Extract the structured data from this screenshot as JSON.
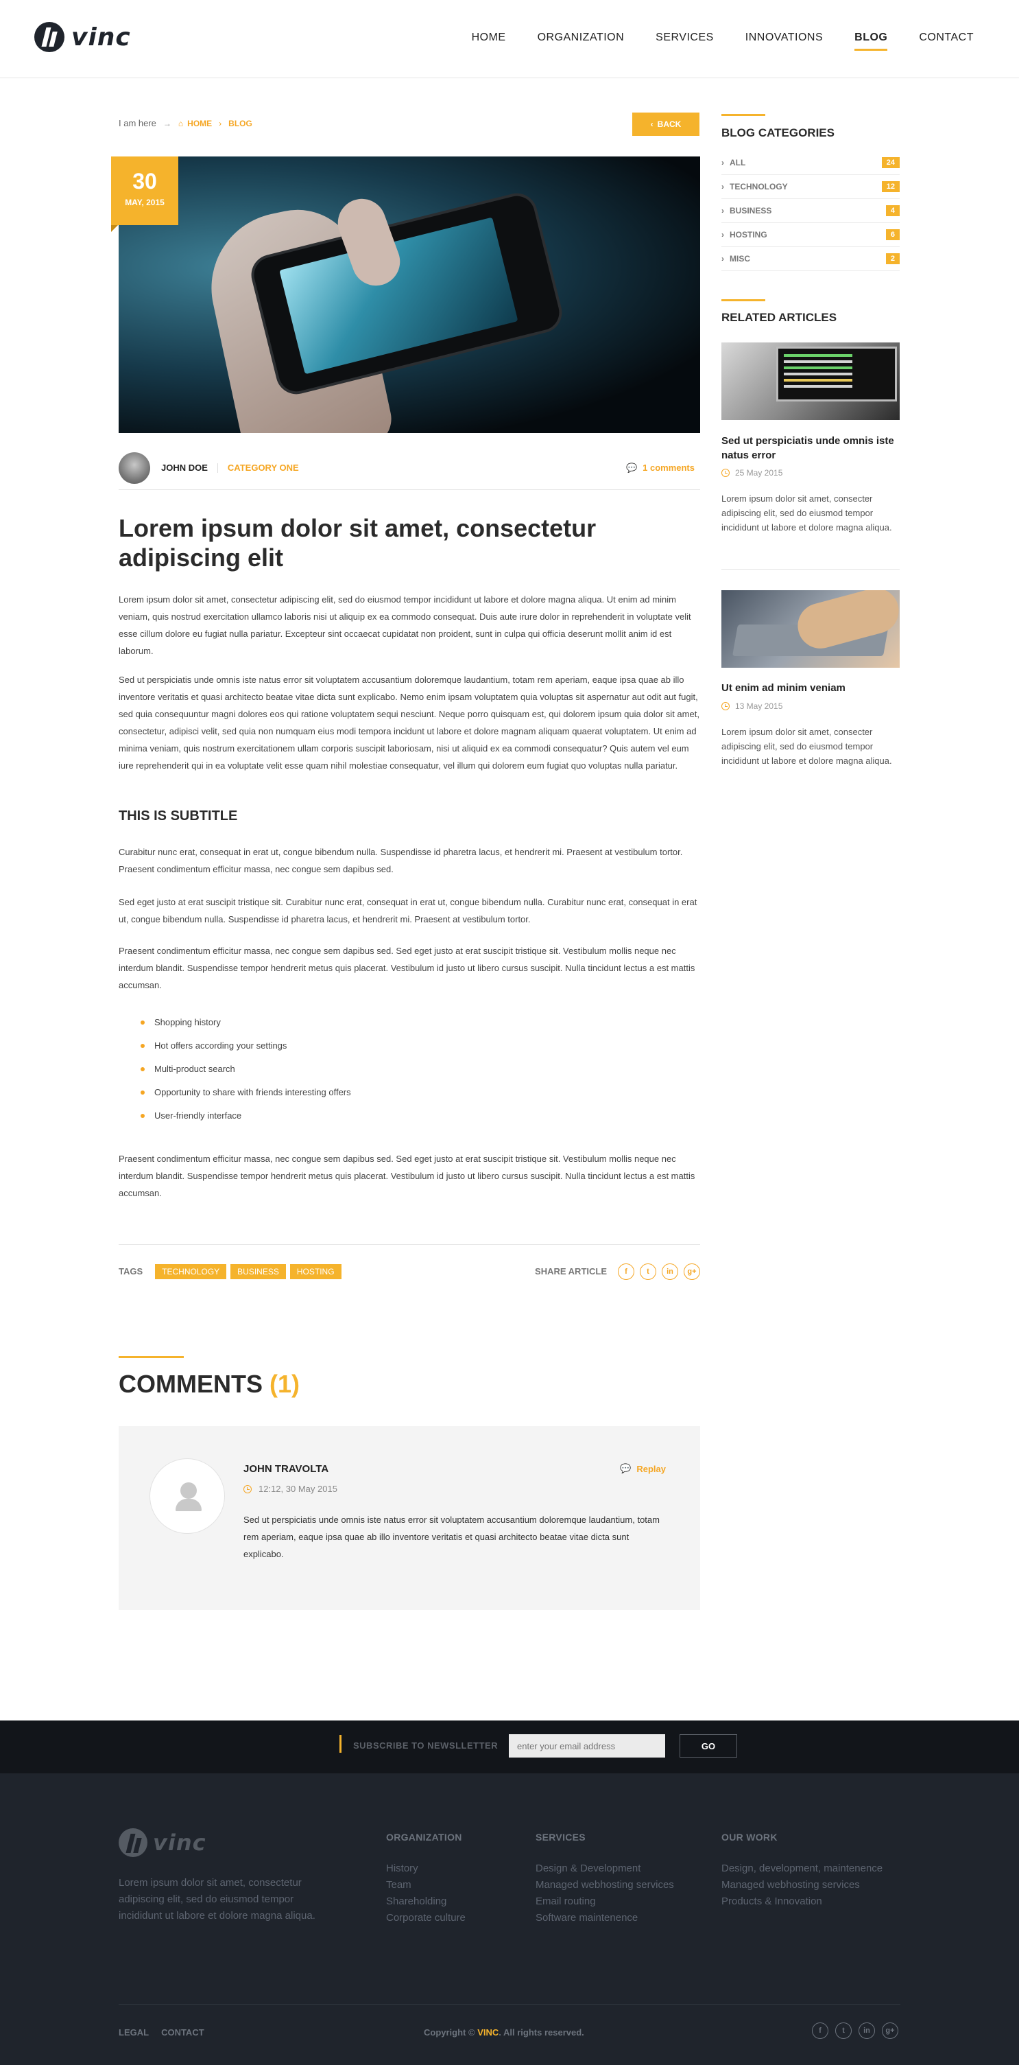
{
  "brand": {
    "logo_text": "vinc"
  },
  "nav": {
    "items": [
      {
        "label": "HOME"
      },
      {
        "label": "ORGANIZATION"
      },
      {
        "label": "SERVICES"
      },
      {
        "label": "INNOVATIONS"
      },
      {
        "label": "BLOG",
        "active": true
      },
      {
        "label": "CONTACT"
      }
    ]
  },
  "breadcrumb": {
    "prefix": "I am here",
    "home": "HOME",
    "current": "BLOG"
  },
  "back_button": {
    "label": "BACK"
  },
  "post": {
    "date_day": "30",
    "date_month": "MAY, 2015",
    "author": "JOHN DOE",
    "category": "CATEGORY ONE",
    "comments_link": "1 comments",
    "title": "Lorem ipsum dolor sit amet, consectetur adipiscing elit",
    "p1": "Lorem ipsum dolor sit amet, consectetur adipiscing elit, sed do eiusmod tempor incididunt ut labore et dolore magna aliqua. Ut enim ad minim veniam, quis nostrud exercitation ullamco laboris nisi ut aliquip ex ea commodo consequat. Duis aute irure dolor in reprehenderit in voluptate velit esse cillum dolore eu fugiat nulla pariatur. Excepteur sint occaecat cupidatat non proident, sunt in culpa qui officia deserunt mollit anim id est laborum.",
    "p2": "Sed ut perspiciatis unde omnis iste natus error sit voluptatem accusantium doloremque laudantium, totam rem aperiam, eaque ipsa quae ab illo inventore veritatis et quasi architecto beatae vitae dicta sunt explicabo. Nemo enim ipsam voluptatem quia voluptas sit aspernatur aut odit aut fugit, sed quia consequuntur magni dolores eos qui ratione voluptatem sequi nesciunt. Neque porro quisquam est, qui dolorem ipsum quia dolor sit amet, consectetur, adipisci velit, sed quia non numquam eius modi tempora incidunt ut labore et dolore magnam aliquam quaerat voluptatem. Ut enim ad minima veniam, quis nostrum exercitationem ullam corporis suscipit laboriosam, nisi ut aliquid ex ea commodi consequatur? Quis autem vel eum iure reprehenderit qui in ea voluptate velit esse quam nihil molestiae consequatur, vel illum qui dolorem eum fugiat quo voluptas nulla pariatur.",
    "subtitle": "THIS IS SUBTITLE",
    "p3": "Curabitur nunc erat, consequat in erat ut, congue bibendum nulla. Suspendisse id pharetra lacus, et hendrerit mi. Praesent at vestibulum tortor. Praesent condimentum efficitur massa, nec congue sem dapibus sed.",
    "p4": "Sed eget justo at erat suscipit tristique sit. Curabitur nunc erat, consequat in erat ut, congue bibendum nulla. Curabitur nunc erat, consequat in erat ut, congue bibendum nulla. Suspendisse id pharetra lacus, et hendrerit mi. Praesent at vestibulum tortor.",
    "p5": "Praesent condimentum efficitur massa, nec congue sem dapibus sed. Sed eget justo at erat suscipit tristique sit. Vestibulum mollis neque nec interdum blandit. Suspendisse tempor hendrerit metus quis placerat. Vestibulum id justo ut libero cursus suscipit. Nulla tincidunt lectus a est mattis accumsan.",
    "bullets": [
      "Shopping history",
      "Hot offers according your settings",
      "Multi-product search",
      "Opportunity to share with friends interesting offers",
      "User-friendly interface"
    ],
    "p6": "Praesent condimentum efficitur massa, nec congue sem dapibus sed. Sed eget justo at erat suscipit tristique sit. Vestibulum mollis neque nec interdum blandit. Suspendisse tempor hendrerit metus quis placerat. Vestibulum id justo ut libero cursus suscipit. Nulla tincidunt lectus a est mattis accumsan.",
    "tags_label": "TAGS",
    "tags": [
      "TECHNOLOGY",
      "BUSINESS",
      "HOSTING"
    ],
    "share_label": "SHARE ARTICLE"
  },
  "comments": {
    "title": "COMMENTS",
    "count": "(1)",
    "items": [
      {
        "name": "JOHN TRAVOLTA",
        "date": "12:12, 30 May 2015",
        "reply": "Replay",
        "text": "Sed ut perspiciatis unde omnis iste natus error sit voluptatem accusantium doloremque laudantium, totam rem aperiam, eaque ipsa quae ab illo inventore veritatis et quasi architecto beatae vitae dicta sunt explicabo."
      }
    ]
  },
  "sidebar": {
    "categories_title": "BLOG CATEGORIES",
    "categories": [
      {
        "name": "ALL",
        "count": "24"
      },
      {
        "name": "TECHNOLOGY",
        "count": "12"
      },
      {
        "name": "BUSINESS",
        "count": "4"
      },
      {
        "name": "HOSTING",
        "count": "6"
      },
      {
        "name": "MISC",
        "count": "2"
      }
    ],
    "related_title": "RELATED ARTICLES",
    "related": [
      {
        "title": "Sed ut perspiciatis unde omnis iste natus error",
        "date": "25 May 2015",
        "text": "Lorem ipsum dolor sit amet, consecter adipiscing elit, sed do eiusmod tempor incididunt ut labore et dolore magna aliqua."
      },
      {
        "title": "Ut enim ad minim veniam",
        "date": "13 May 2015",
        "text": "Lorem ipsum dolor sit amet, consecter adipiscing elit, sed do eiusmod tempor incididunt ut labore et dolore magna aliqua."
      }
    ]
  },
  "newsletter": {
    "label": "SUBSCRIBE TO NEWSLLETTER",
    "placeholder": "enter your email address",
    "button": "GO"
  },
  "footer": {
    "logo_text": "vinc",
    "about": "Lorem ipsum dolor sit amet, consectetur adipiscing elit, sed do eiusmod tempor incididunt ut labore et dolore magna aliqua.",
    "columns": [
      {
        "title": "ORGANIZATION",
        "links": [
          "History",
          "Team",
          "Shareholding",
          "Corporate culture"
        ]
      },
      {
        "title": "SERVICES",
        "links": [
          "Design & Development",
          "Managed webhosting services",
          "Email routing",
          "Software maintenence"
        ]
      },
      {
        "title": "OUR WORK",
        "links": [
          "Design, development, maintenence",
          "Managed webhosting services",
          "Products & Innovation"
        ]
      }
    ],
    "legal": "LEGAL",
    "contact": "CONTACT",
    "copyright_prefix": "Copyright ©",
    "copyright_brand": "VINC",
    "copyright_suffix": ". All rights reserved."
  },
  "social": {
    "icons": [
      {
        "name": "facebook-icon",
        "glyph": "f"
      },
      {
        "name": "twitter-icon",
        "glyph": "t"
      },
      {
        "name": "linkedin-icon",
        "glyph": "in"
      },
      {
        "name": "googleplus-icon",
        "glyph": "g+"
      }
    ]
  },
  "colors": {
    "accent": "#f5b32c",
    "dark": "#1f242c",
    "newsletter_bg": "#12151a"
  }
}
